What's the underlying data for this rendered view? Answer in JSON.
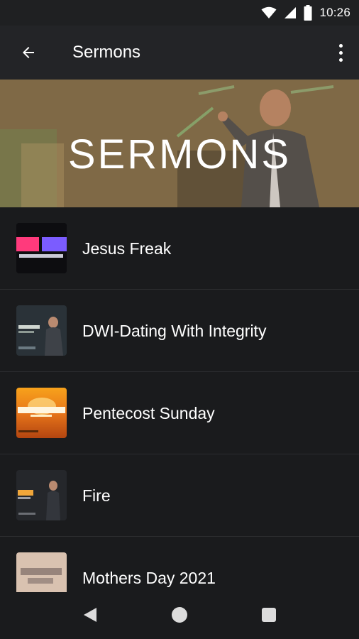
{
  "status_bar": {
    "time": "10:26"
  },
  "app_bar": {
    "title": "Sermons"
  },
  "hero": {
    "title": "SERMONS"
  },
  "sermons": [
    {
      "title": "Jesus Freak"
    },
    {
      "title": "DWI-Dating With Integrity"
    },
    {
      "title": "Pentecost Sunday"
    },
    {
      "title": "Fire"
    },
    {
      "title": "Mothers Day 2021"
    }
  ]
}
